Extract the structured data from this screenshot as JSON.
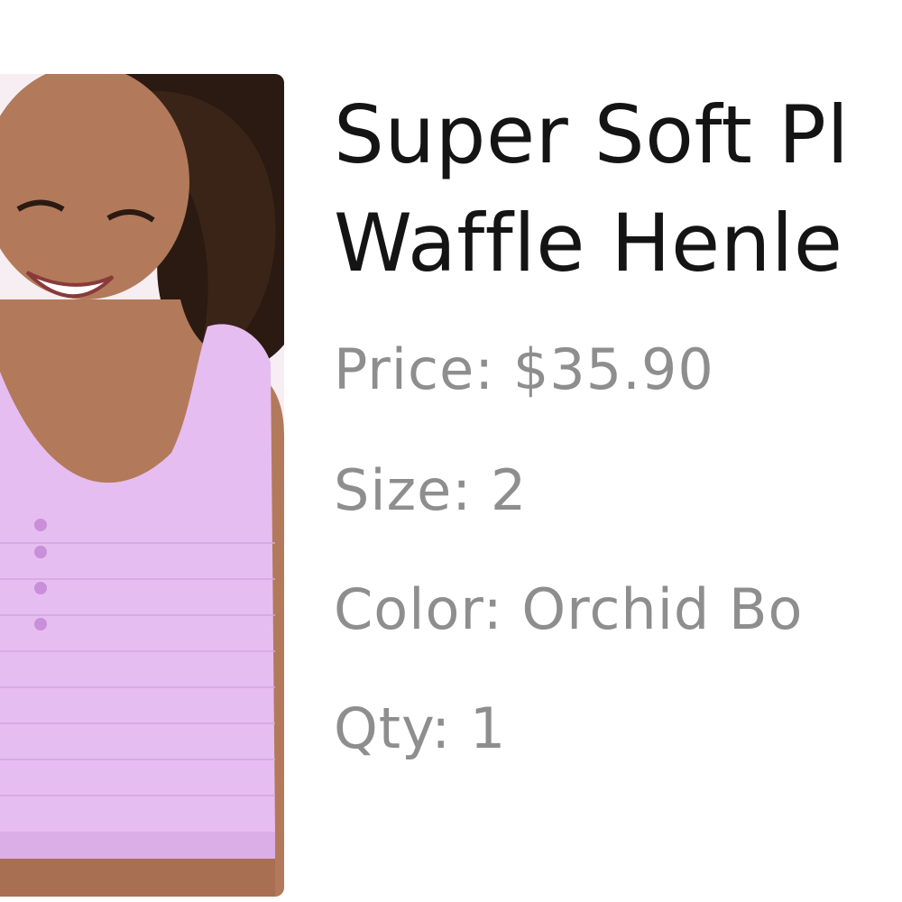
{
  "product": {
    "title_line1": "Super Soft Pl",
    "title_line2": "Waffle Henle",
    "image_icon": "product-photo-icon",
    "attributes": {
      "price": {
        "label": "Price:",
        "value": "$35.90"
      },
      "size": {
        "label": "Size:",
        "value": "2"
      },
      "color": {
        "label": "Color:",
        "value": "Orchid Bo"
      },
      "qty": {
        "label": "Qty:",
        "value": "1"
      }
    }
  },
  "colors": {
    "title": "#141414",
    "attribute_text": "#8e8e8e",
    "garment": "#e6bdf0",
    "background": "#ffffff"
  }
}
